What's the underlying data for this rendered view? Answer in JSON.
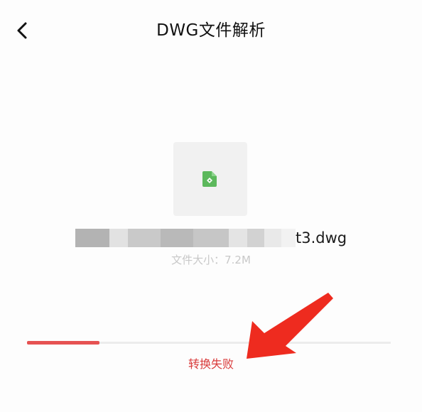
{
  "header": {
    "title": "DWG文件解析",
    "back_icon": "chevron-left-icon"
  },
  "file": {
    "icon": "dwg-file-icon",
    "name_visible_suffix": "t3.dwg",
    "size_text": "文件大小：7.2M"
  },
  "conversion": {
    "progress": 0.2,
    "status": "转换失败"
  },
  "colors": {
    "progress_fill": "#e65252",
    "status": "#d93b3b",
    "file_icon": "#5cb85c",
    "annotation_arrow": "#ee2b1f"
  }
}
